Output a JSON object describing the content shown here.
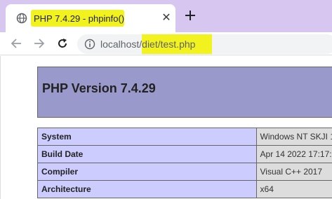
{
  "tab": {
    "title": "PHP 7.4.29 - phpinfo()",
    "close_glyph": "✕"
  },
  "toolbar": {
    "icons": [
      "back-arrow-icon",
      "forward-arrow-icon",
      "reload-icon",
      "info-icon"
    ],
    "url_host": "localhost/",
    "url_path": "diet/test.php"
  },
  "page": {
    "title": "PHP Version 7.4.29",
    "rows": [
      {
        "label": "System",
        "value": "Windows NT SKJI 1"
      },
      {
        "label": "Build Date",
        "value": "Apr 14 2022 17:17:"
      },
      {
        "label": "Compiler",
        "value": "Visual C++ 2017"
      },
      {
        "label": "Architecture",
        "value": "x64"
      }
    ]
  },
  "colors": {
    "tabstrip": "#d7c6ef",
    "highlight": "#f2f21e",
    "header_bg": "#9999cc",
    "label_bg": "#ccccff",
    "value_bg": "#dddddd"
  }
}
